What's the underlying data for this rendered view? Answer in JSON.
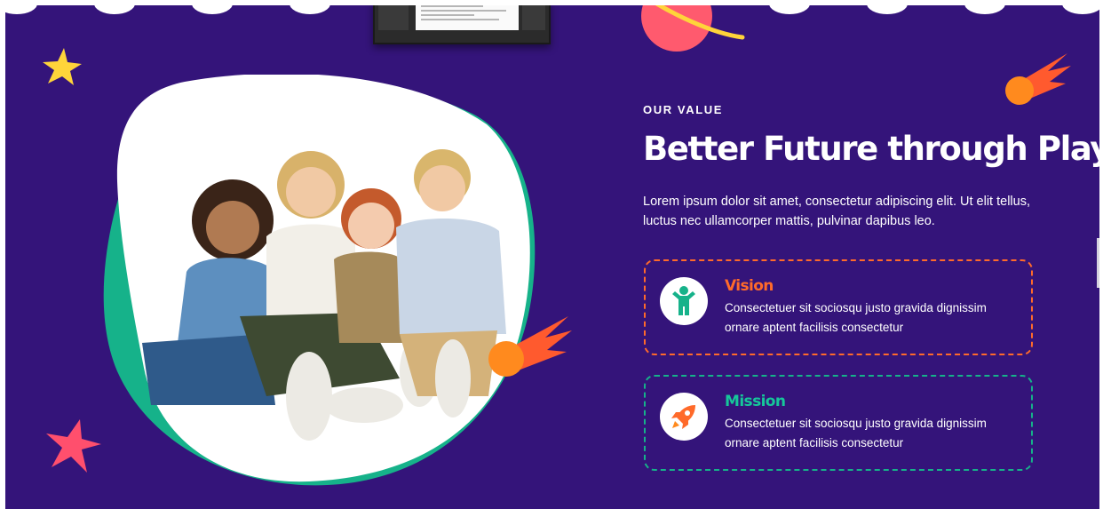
{
  "section": {
    "eyebrow": "OUR VALUE",
    "headline": "Better Future through Play",
    "intro": "Lorem ipsum dolor sit amet, consectetur adipiscing elit. Ut elit tellus, luctus nec ullamcorper mattis, pulvinar dapibus leo."
  },
  "cards": [
    {
      "title": "Vision",
      "text": "Consectetuer sit sociosqu justo gravida dignissim ornare aptent facilisis consectetur",
      "icon": "child-icon",
      "color": "#ff6a2a"
    },
    {
      "title": "Mission",
      "text": "Consectetuer sit sociosqu justo gravida dignissim ornare aptent facilisis consectetur",
      "icon": "rocket-icon",
      "color": "#16c79a"
    }
  ],
  "colors": {
    "background": "#34147a",
    "accent_orange": "#ff6a2a",
    "accent_green": "#16b28a",
    "star_yellow": "#ffd43a",
    "star_pink": "#ff4f6d",
    "planet": "#ff5a6e"
  },
  "decorations": {
    "photo": "children-group-photo",
    "top_shape": "scalloped-edge",
    "icons": [
      "planet-icon",
      "star-icon",
      "comet-icon"
    ]
  }
}
